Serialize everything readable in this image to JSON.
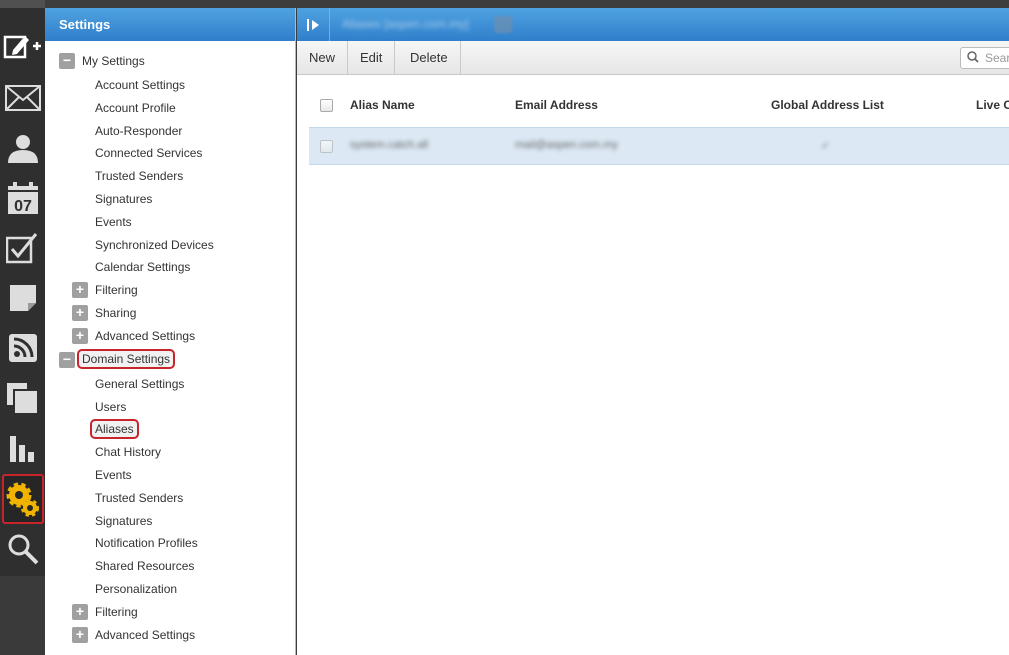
{
  "rail": {
    "icons": [
      "compose-icon",
      "mail-icon",
      "contacts-icon",
      "calendar-icon",
      "tasks-icon",
      "notes-icon",
      "rss-icon",
      "files-icon",
      "reports-icon",
      "settings-icon",
      "search-icon"
    ],
    "calendar_day": "07"
  },
  "settings": {
    "title": "Settings",
    "my_settings": {
      "label": "My Settings",
      "items": [
        "Account Settings",
        "Account Profile",
        "Auto-Responder",
        "Connected Services",
        "Trusted Senders",
        "Signatures",
        "Events",
        "Synchronized Devices",
        "Calendar Settings"
      ],
      "collapsed": [
        "Filtering",
        "Sharing",
        "Advanced Settings"
      ]
    },
    "domain_settings": {
      "label": "Domain Settings",
      "items": [
        "General Settings",
        "Users",
        "Aliases",
        "Chat History",
        "Events",
        "Trusted Senders",
        "Signatures",
        "Notification Profiles",
        "Shared Resources",
        "Personalization"
      ],
      "collapsed": [
        "Filtering",
        "Advanced Settings"
      ]
    }
  },
  "main": {
    "title": "Aliases [aspen.com.my]",
    "toolbar": {
      "new": "New",
      "edit": "Edit",
      "delete": "Delete",
      "search_placeholder": "Sear"
    },
    "columns": [
      "Alias Name",
      "Email Address",
      "Global Address List",
      "Live C"
    ],
    "rows": [
      {
        "alias": "system.catch.all",
        "email": "mail@aspen.com.my",
        "gal": "✓"
      }
    ]
  },
  "colors": {
    "accent_blue": "#2f7fcb",
    "highlight_red": "#c8242b",
    "row_selected": "#dce9f5"
  }
}
